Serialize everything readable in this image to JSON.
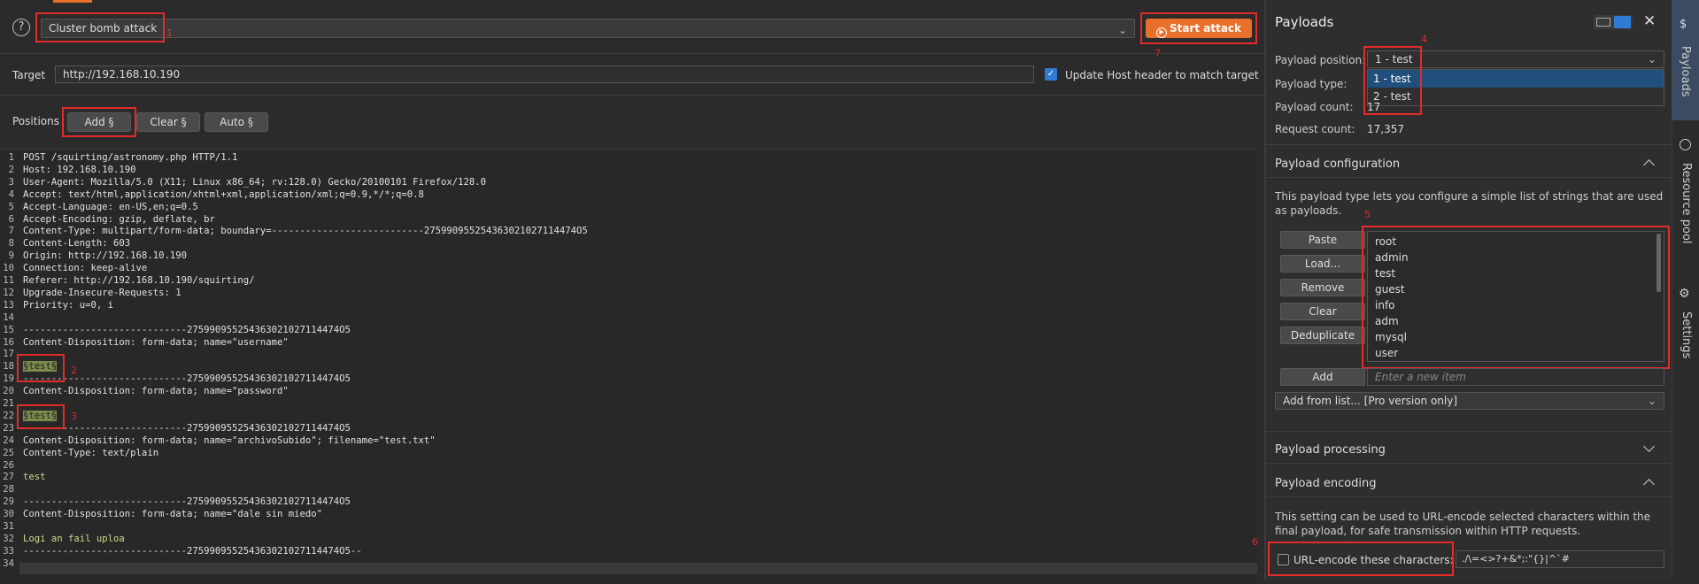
{
  "attack": {
    "type_value": "Cluster bomb attack",
    "start_label": "Start attack"
  },
  "target": {
    "label": "Target",
    "value": "http://192.168.10.190",
    "update_host_label": "Update Host header to match target",
    "update_host_checked": true
  },
  "positions": {
    "label": "Positions",
    "add_label": "Add §",
    "clear_label": "Clear §",
    "auto_label": "Auto §"
  },
  "request_lines": [
    "POST /squirting/astronomy.php HTTP/1.1",
    "Host: 192.168.10.190",
    "User-Agent: Mozilla/5.0 (X11; Linux x86_64; rv:128.0) Gecko/20100101 Firefox/128.0",
    "Accept: text/html,application/xhtml+xml,application/xml;q=0.9,*/*;q=0.8",
    "Accept-Language: en-US,en;q=0.5",
    "Accept-Encoding: gzip, deflate, br",
    "Content-Type: multipart/form-data; boundary=---------------------------275990955254363021027114474O5",
    "Content-Length: 603",
    "Origin: http://192.168.10.190",
    "Connection: keep-alive",
    "Referer: http://192.168.10.190/squirting/",
    "Upgrade-Insecure-Requests: 1",
    "Priority: u=0, i",
    "",
    "-----------------------------275990955254363021027114474O5",
    "Content-Disposition: form-data; name=\"username\"",
    "",
    "§test§",
    "-----------------------------275990955254363021027114474O5",
    "Content-Disposition: form-data; name=\"password\"",
    "",
    "§test§",
    "-----------------------------275990955254363021027114474O5",
    "Content-Disposition: form-data; name=\"archivoSubido\"; filename=\"test.txt\"",
    "Content-Type: text/plain",
    "",
    "test",
    "",
    "-----------------------------275990955254363021027114474O5",
    "Content-Disposition: form-data; name=\"dale sin miedo\"",
    "",
    "Logi an fail uploa",
    "-----------------------------275990955254363021027114474O5--",
    ""
  ],
  "line_numbers": [
    "1",
    "2",
    "3",
    "4",
    "5",
    "6",
    "7",
    "8",
    "9",
    "10",
    "11",
    "12",
    "13",
    "14",
    "15",
    "16",
    "17",
    "18",
    "19",
    "20",
    "21",
    "22",
    "23",
    "24",
    "25",
    "26",
    "27",
    "28",
    "29",
    "30",
    "31",
    "32",
    "33",
    "34"
  ],
  "annotations": [
    "1",
    "2",
    "3",
    "4",
    "5",
    "6",
    "7"
  ],
  "payloads": {
    "title": "Payloads",
    "position_label": "Payload position:",
    "position_value": "1 - test",
    "position_options": [
      "1 - test",
      "2 - test"
    ],
    "type_label": "Payload type:",
    "count_label": "Payload count:",
    "count_value": "17",
    "request_count_label": "Request count:",
    "request_count_value": "17,357"
  },
  "config": {
    "title": "Payload configuration",
    "description": "This payload type lets you configure a simple list of strings that are used as payloads.",
    "buttons": [
      "Paste",
      "Load...",
      "Remove",
      "Clear",
      "Deduplicate"
    ],
    "items": [
      "root",
      "admin",
      "test",
      "guest",
      "info",
      "adm",
      "mysql",
      "user"
    ],
    "add_label": "Add",
    "add_placeholder": "Enter a new item",
    "add_from_list": "Add from list... [Pro version only]"
  },
  "processing": {
    "title": "Payload processing"
  },
  "encoding": {
    "title": "Payload encoding",
    "description": "This setting can be used to URL-encode selected characters within the final payload, for safe transmission within HTTP requests.",
    "checkbox_label": "URL-encode these characters:",
    "characters": "./\\=<>?+&*;:\"{}|^`#"
  },
  "rail": {
    "payloads": "Payloads",
    "resource_pool": "Resource pool",
    "settings": "Settings"
  },
  "colors": {
    "accent": "#e8702a",
    "annotation": "#e32b2b",
    "selection": "#1f4f7a",
    "marker": "#7a8b4d"
  }
}
